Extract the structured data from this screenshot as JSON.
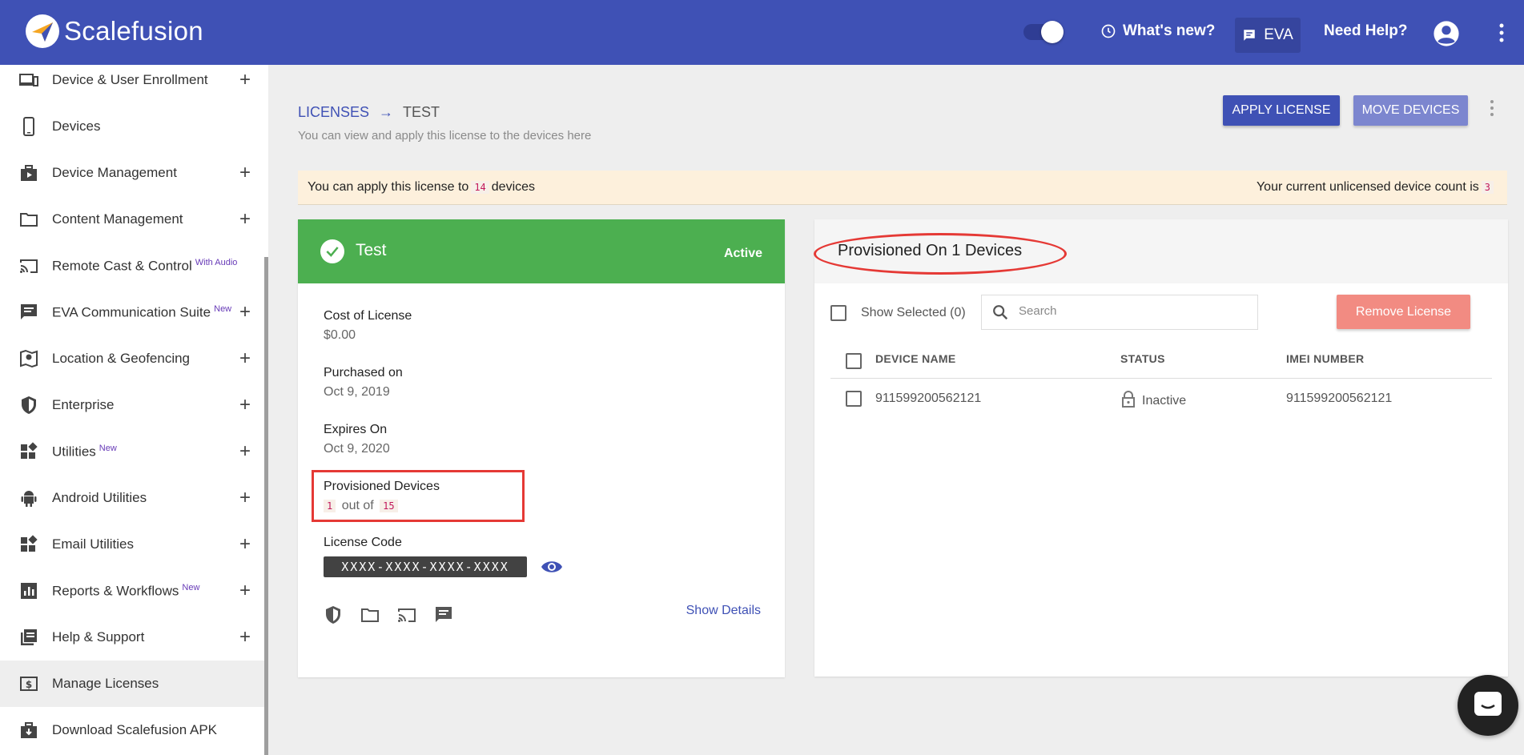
{
  "header": {
    "brand": "Scalefusion",
    "whats_new": "What's new?",
    "eva": "EVA",
    "need_help": "Need Help?"
  },
  "sidebar": {
    "items": [
      {
        "label": "Device & User Enrollment",
        "badge": "",
        "icon": "enrollment-icon"
      },
      {
        "label": "Devices",
        "badge": "",
        "icon": "phone-icon"
      },
      {
        "label": "Device Management",
        "badge": "",
        "icon": "briefcase-icon"
      },
      {
        "label": "Content Management",
        "badge": "",
        "icon": "folder-icon"
      },
      {
        "label": "Remote Cast & Control",
        "badge": "With Audio",
        "icon": "cast-icon"
      },
      {
        "label": "EVA Communication Suite",
        "badge": "New",
        "icon": "chat-icon"
      },
      {
        "label": "Location & Geofencing",
        "badge": "",
        "icon": "map-pin-icon"
      },
      {
        "label": "Enterprise",
        "badge": "",
        "icon": "shield-icon"
      },
      {
        "label": "Utilities",
        "badge": "New",
        "icon": "widgets-icon"
      },
      {
        "label": "Android Utilities",
        "badge": "",
        "icon": "android-icon"
      },
      {
        "label": "Email Utilities",
        "badge": "",
        "icon": "widgets-icon"
      },
      {
        "label": "Reports & Workflows",
        "badge": "New",
        "icon": "chart-icon"
      },
      {
        "label": "Help & Support",
        "badge": "",
        "icon": "book-icon"
      },
      {
        "label": "Manage Licenses",
        "badge": "",
        "icon": "license-icon"
      },
      {
        "label": "Download Scalefusion APK",
        "badge": "",
        "icon": "download-icon"
      }
    ]
  },
  "breadcrumb": {
    "root": "LICENSES",
    "arrow": "→",
    "current": "TEST"
  },
  "subtitle": "You can view and apply this license to the devices here",
  "actions": {
    "apply": "APPLY LICENSE",
    "move": "MOVE DEVICES"
  },
  "notice": {
    "left_prefix": "You can apply this license to",
    "left_count": "14",
    "left_suffix": "devices",
    "right_prefix": "Your current unlicensed device count is",
    "right_count": "3"
  },
  "license": {
    "name": "Test",
    "status": "Active",
    "cost_label": "Cost of License",
    "cost": "$0.00",
    "purchased_label": "Purchased on",
    "purchased": "Oct 9, 2019",
    "expires_label": "Expires On",
    "expires": "Oct 9, 2020",
    "provisioned_label": "Provisioned Devices",
    "provisioned_used": "1",
    "provisioned_of": "out of",
    "provisioned_total": "15",
    "code_label": "License Code",
    "code": "XXXX-XXXX-XXXX-XXXX",
    "show_details": "Show Details"
  },
  "provisioned": {
    "title": "Provisioned On 1 Devices",
    "show_selected": "Show Selected (0)",
    "search_placeholder": "Search",
    "remove": "Remove License",
    "columns": [
      "DEVICE NAME",
      "STATUS",
      "IMEI NUMBER"
    ],
    "rows": [
      {
        "device_name": "911599200562121",
        "status": "Inactive",
        "imei": "911599200562121"
      }
    ]
  },
  "colors": {
    "primary": "#3f51b5",
    "active": "#4caf50",
    "danger": "#f28b82",
    "highlight": "#e53935"
  }
}
